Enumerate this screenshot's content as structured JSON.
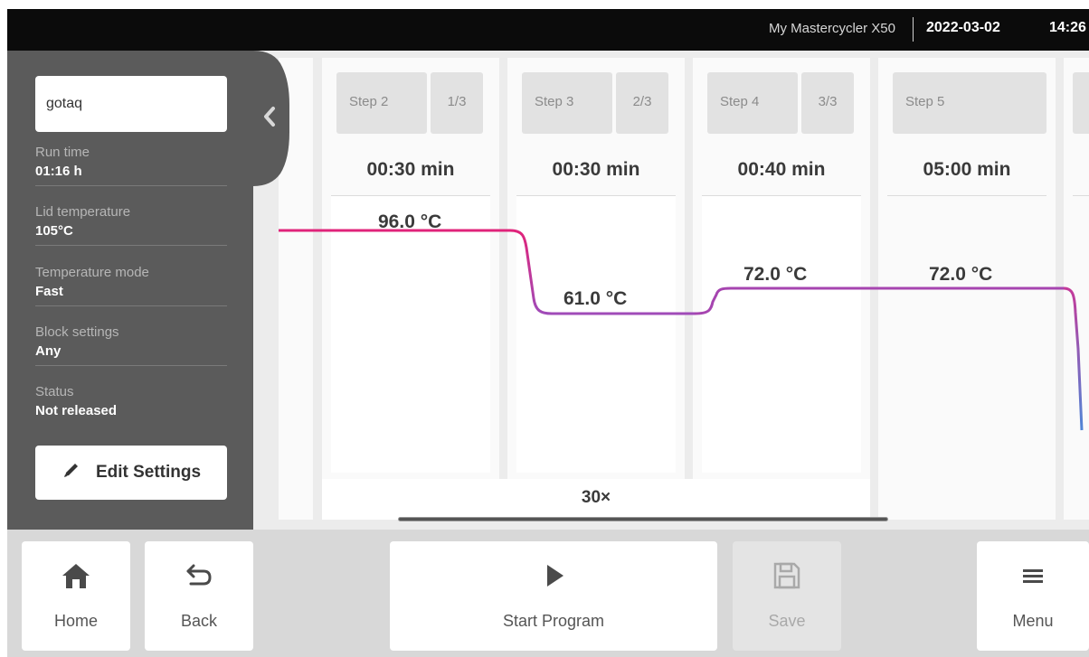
{
  "status_bar": {
    "device_name": "My Mastercycler X50",
    "date": "2022-03-02",
    "time": "14:26"
  },
  "program": {
    "name": "gotaq",
    "properties": [
      {
        "label": "Run time",
        "value": "01:16 h"
      },
      {
        "label": "Lid temperature",
        "value": "105°C"
      },
      {
        "label": "Temperature mode",
        "value": "Fast"
      },
      {
        "label": "Block settings",
        "value": "Any"
      },
      {
        "label": "Status",
        "value": "Not released"
      }
    ],
    "edit_settings_label": "Edit Settings"
  },
  "steps": [
    {
      "label": "Step 2",
      "cycle_index": "1/3",
      "duration": "00:30 min",
      "temperature": "96.0 °C"
    },
    {
      "label": "Step 3",
      "cycle_index": "2/3",
      "duration": "00:30 min",
      "temperature": "61.0 °C"
    },
    {
      "label": "Step 4",
      "cycle_index": "3/3",
      "duration": "00:40 min",
      "temperature": "72.0 °C"
    },
    {
      "label": "Step 5",
      "cycle_index": "",
      "duration": "05:00 min",
      "temperature": "72.0 °C"
    }
  ],
  "cycle_repeat": "30×",
  "bottom_bar": {
    "home_label": "Home",
    "back_label": "Back",
    "start_label": "Start Program",
    "save_label": "Save",
    "menu_label": "Menu"
  },
  "icons": {
    "collapse": "chevron-left-icon",
    "edit": "pencil-icon",
    "home": "home-icon",
    "back": "back-arrow-icon",
    "start": "play-icon",
    "save": "floppy-disk-icon",
    "menu": "hamburger-menu-icon"
  },
  "colors": {
    "curve_hot": "#e0237a",
    "curve_mid": "#a04bb8",
    "curve_cold": "#4f86d6",
    "panel": "#5b5b5b",
    "status_bar": "#0b0b0b"
  }
}
